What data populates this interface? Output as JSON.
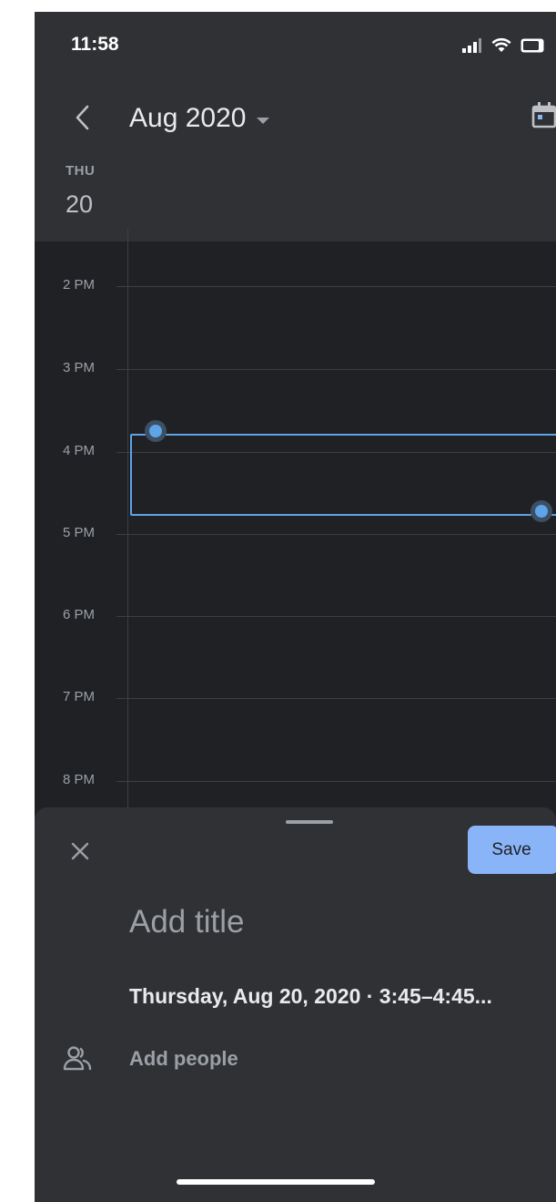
{
  "status_bar": {
    "time": "11:58",
    "icons": [
      "signal-icon",
      "wifi-icon",
      "battery-icon"
    ]
  },
  "header": {
    "month_label": "Aug 2020",
    "day_name": "THU",
    "day_number": "20",
    "icons": [
      "back-arrow-icon",
      "dropdown-caret-icon",
      "calendar-icon"
    ]
  },
  "timeline": {
    "hours": [
      "2 PM",
      "3 PM",
      "4 PM",
      "5 PM",
      "6 PM",
      "7 PM",
      "8 PM"
    ],
    "draft_event": {
      "start": "3:45",
      "end": "4:45"
    }
  },
  "sheet": {
    "save_label": "Save",
    "title_placeholder": "Add title",
    "datetime_text": "Thursday, Aug 20, 2020 · 3:45–4:45...",
    "add_people_label": "Add people",
    "icons": [
      "close-icon",
      "people-icon"
    ]
  },
  "colors": {
    "background": "#202124",
    "surface": "#303134",
    "accent": "#8ab4f8",
    "event_outline": "#5fa4e6"
  }
}
